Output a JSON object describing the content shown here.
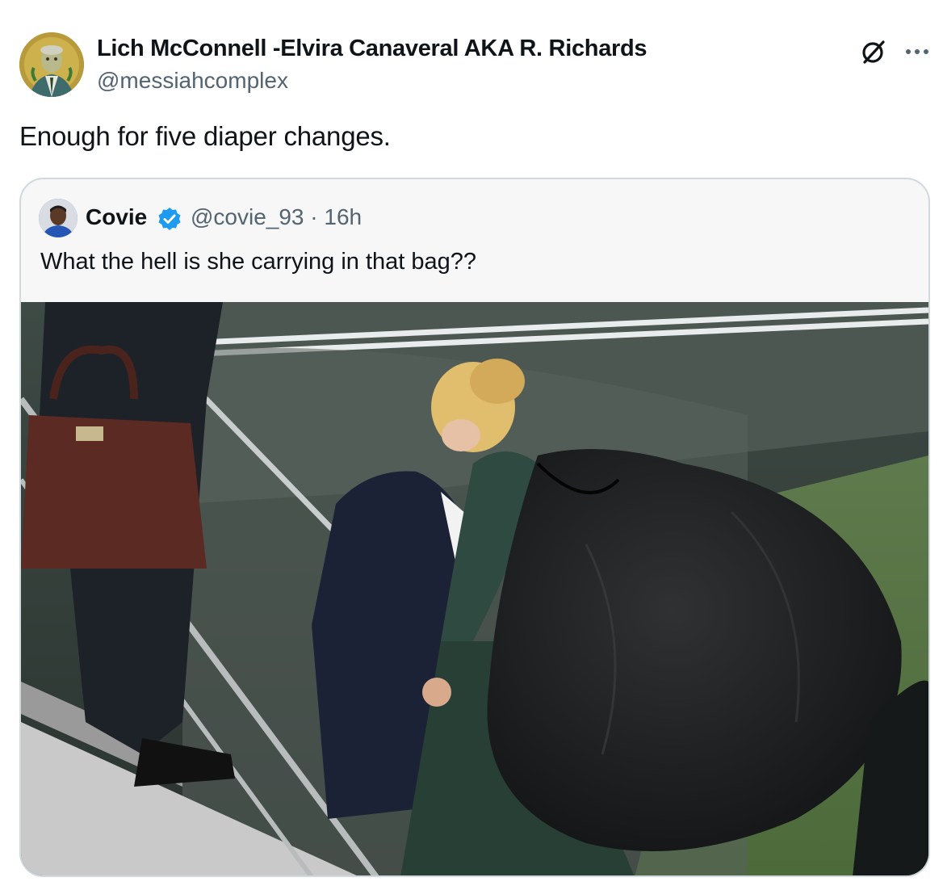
{
  "author": {
    "name": "Lich McConnell -Elvira Canaveral AKA R. Richards",
    "handle": "@messiahcomplex",
    "avatar_icon": "profile-avatar"
  },
  "actions": {
    "grok_icon": "grok-icon",
    "more_icon": "more-options-icon"
  },
  "tweet": {
    "text": "Enough for five diaper changes."
  },
  "quote": {
    "name": "Covie",
    "verified_icon": "verified-badge-icon",
    "handle_time": "@covie_93 · 16h",
    "text": "What the hell is she carrying in that bag??"
  },
  "colors": {
    "text": "#0f1419",
    "secondary": "#536471",
    "border": "#cfd9de",
    "verified": "#1d9bf0"
  }
}
